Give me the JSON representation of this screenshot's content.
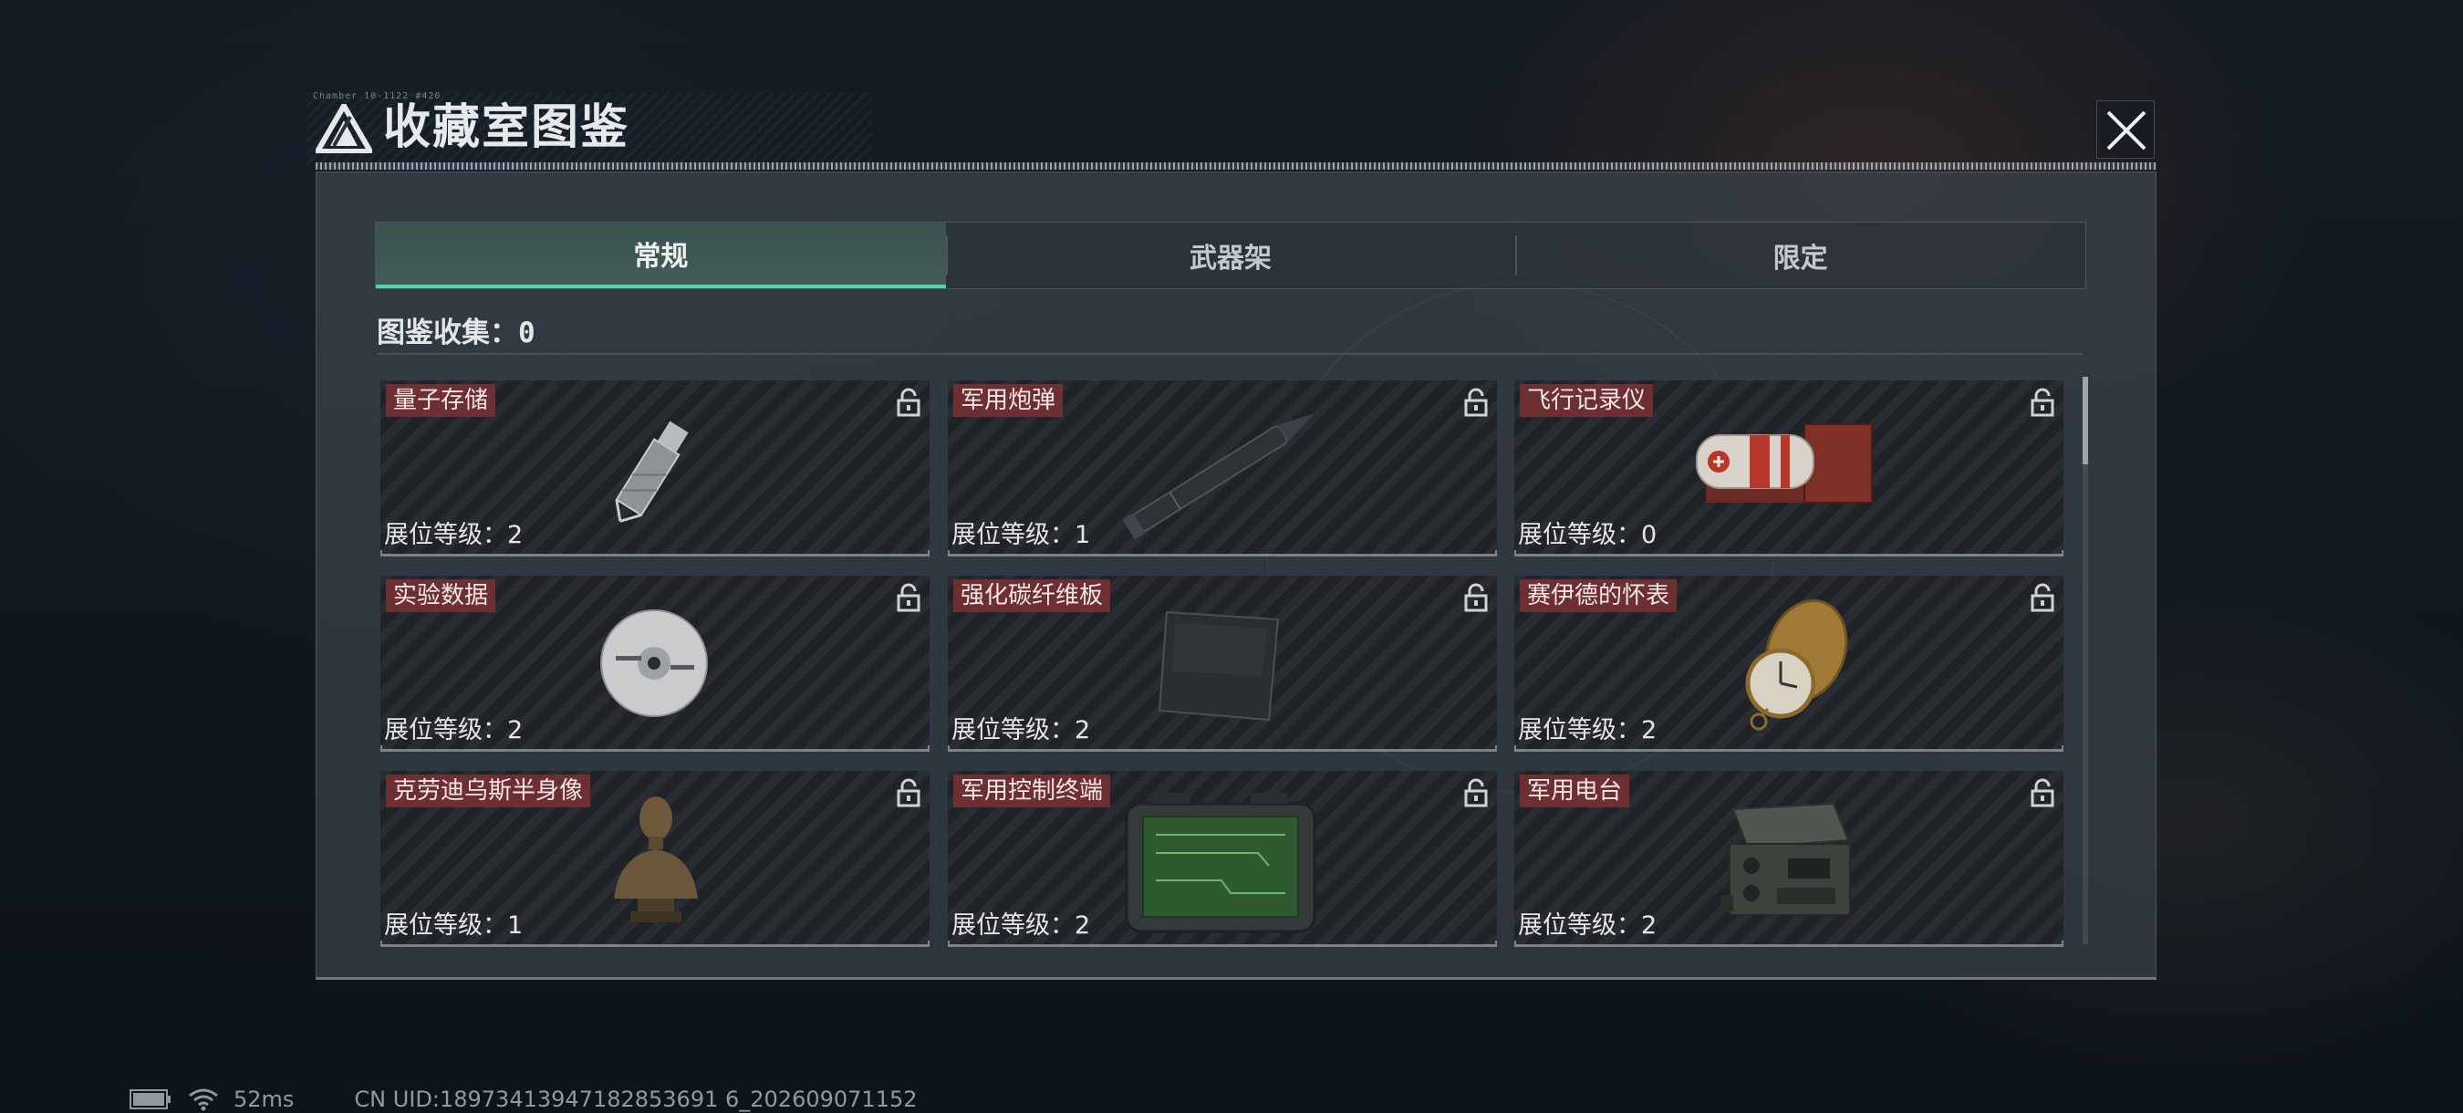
{
  "header": {
    "title": "收藏室图鉴",
    "tiny_text": "Chamber 10-1122 #420"
  },
  "tabs": [
    {
      "label": "常规",
      "active": true
    },
    {
      "label": "武器架",
      "active": false
    },
    {
      "label": "限定",
      "active": false
    }
  ],
  "collection": {
    "label": "图鉴收集：",
    "count": "0"
  },
  "cards": [
    {
      "name": "量子存储",
      "level_label": "展位等级：",
      "level": "2",
      "icon": "usb-drive",
      "locked": true
    },
    {
      "name": "军用炮弹",
      "level_label": "展位等级：",
      "level": "1",
      "icon": "artillery-shell",
      "locked": true
    },
    {
      "name": "飞行记录仪",
      "level_label": "展位等级：",
      "level": "0",
      "icon": "flight-recorder",
      "locked": true
    },
    {
      "name": "实验数据",
      "level_label": "展位等级：",
      "level": "2",
      "icon": "compact-disc",
      "locked": true
    },
    {
      "name": "强化碳纤维板",
      "level_label": "展位等级：",
      "level": "2",
      "icon": "carbon-plate",
      "locked": true
    },
    {
      "name": "赛伊德的怀表",
      "level_label": "展位等级：",
      "level": "2",
      "icon": "pocket-watch",
      "locked": true
    },
    {
      "name": "克劳迪乌斯半身像",
      "level_label": "展位等级：",
      "level": "1",
      "icon": "bust-statue",
      "locked": true
    },
    {
      "name": "军用控制终端",
      "level_label": "展位等级：",
      "level": "2",
      "icon": "control-terminal",
      "locked": true
    },
    {
      "name": "军用电台",
      "level_label": "展位等级：",
      "level": "2",
      "icon": "military-radio",
      "locked": true
    }
  ],
  "status": {
    "ping": "52ms",
    "uid": "CN UID:18973413947182853691 6_202609071152"
  },
  "colors": {
    "accent": "#4ed9a3",
    "name_tag": "#6e2f33",
    "card_bg": "#1f2327"
  }
}
